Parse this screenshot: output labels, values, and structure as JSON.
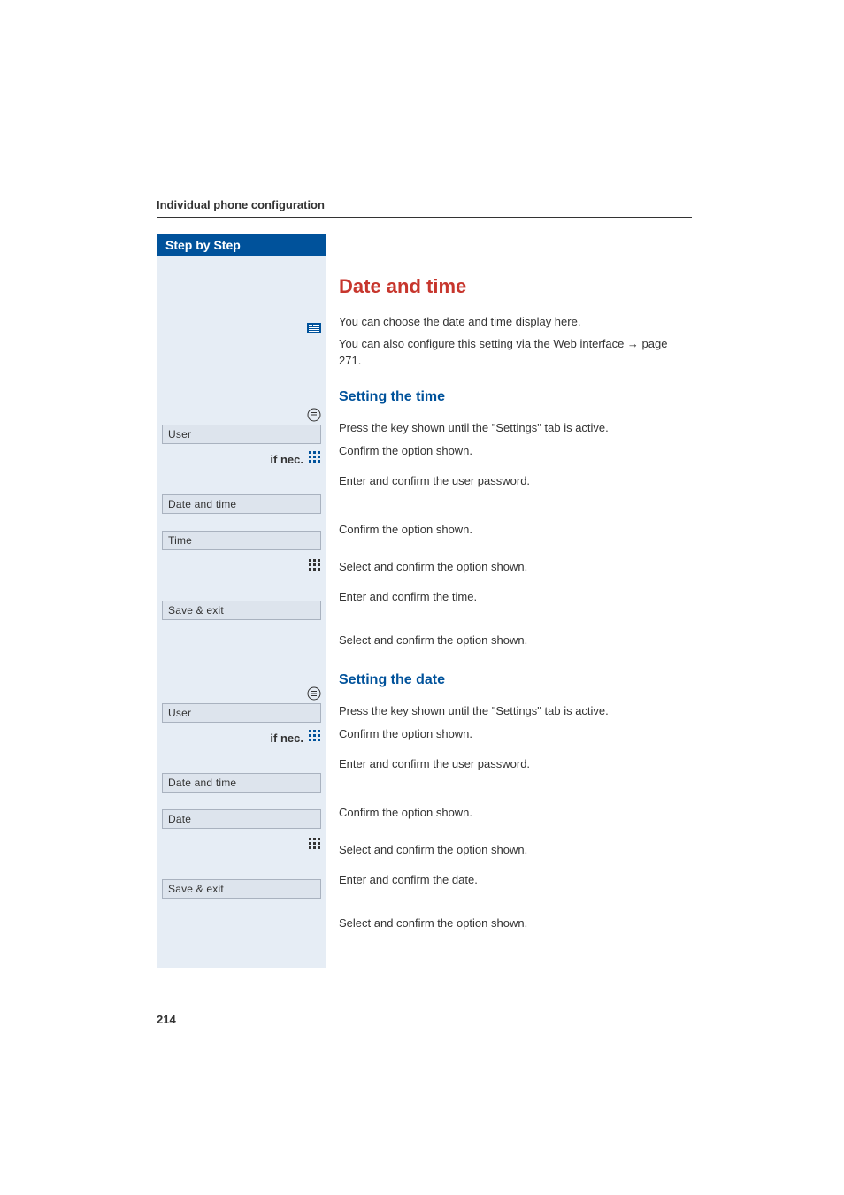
{
  "header": {
    "chapter": "Individual phone configuration"
  },
  "stepByStep": {
    "title": "Step by Step"
  },
  "section": {
    "title": "Date and time",
    "intro1": "You can choose the date and time display here.",
    "intro2_prefix": "You can also configure this setting via the Web interface ",
    "intro2_arrow": "→",
    "intro2_suffix": " page 271."
  },
  "time": {
    "title": "Setting the time",
    "steps": {
      "press_settings": "Press the key shown until the \"Settings\" tab is active.",
      "confirm_user": "Confirm the option shown.",
      "enter_password": "Enter and confirm the user password.",
      "confirm_datetime": "Confirm the option shown.",
      "select_time": "Select and confirm the option shown.",
      "enter_time": "Enter and confirm the time.",
      "save": "Select and confirm the option shown."
    }
  },
  "date": {
    "title": "Setting the date",
    "steps": {
      "press_settings": "Press the key shown until the \"Settings\" tab is active.",
      "confirm_user": "Confirm the option shown.",
      "enter_password": "Enter and confirm the user password.",
      "confirm_datetime": "Confirm the option shown.",
      "select_date": "Select and confirm the option shown.",
      "enter_date": "Enter and confirm the date.",
      "save": "Select and confirm the option shown."
    }
  },
  "leftLabels": {
    "if_nec": "if nec.",
    "user": "User",
    "date_and_time": "Date and time",
    "time": "Time",
    "date": "Date",
    "save_exit": "Save & exit"
  },
  "pageNumber": "214"
}
